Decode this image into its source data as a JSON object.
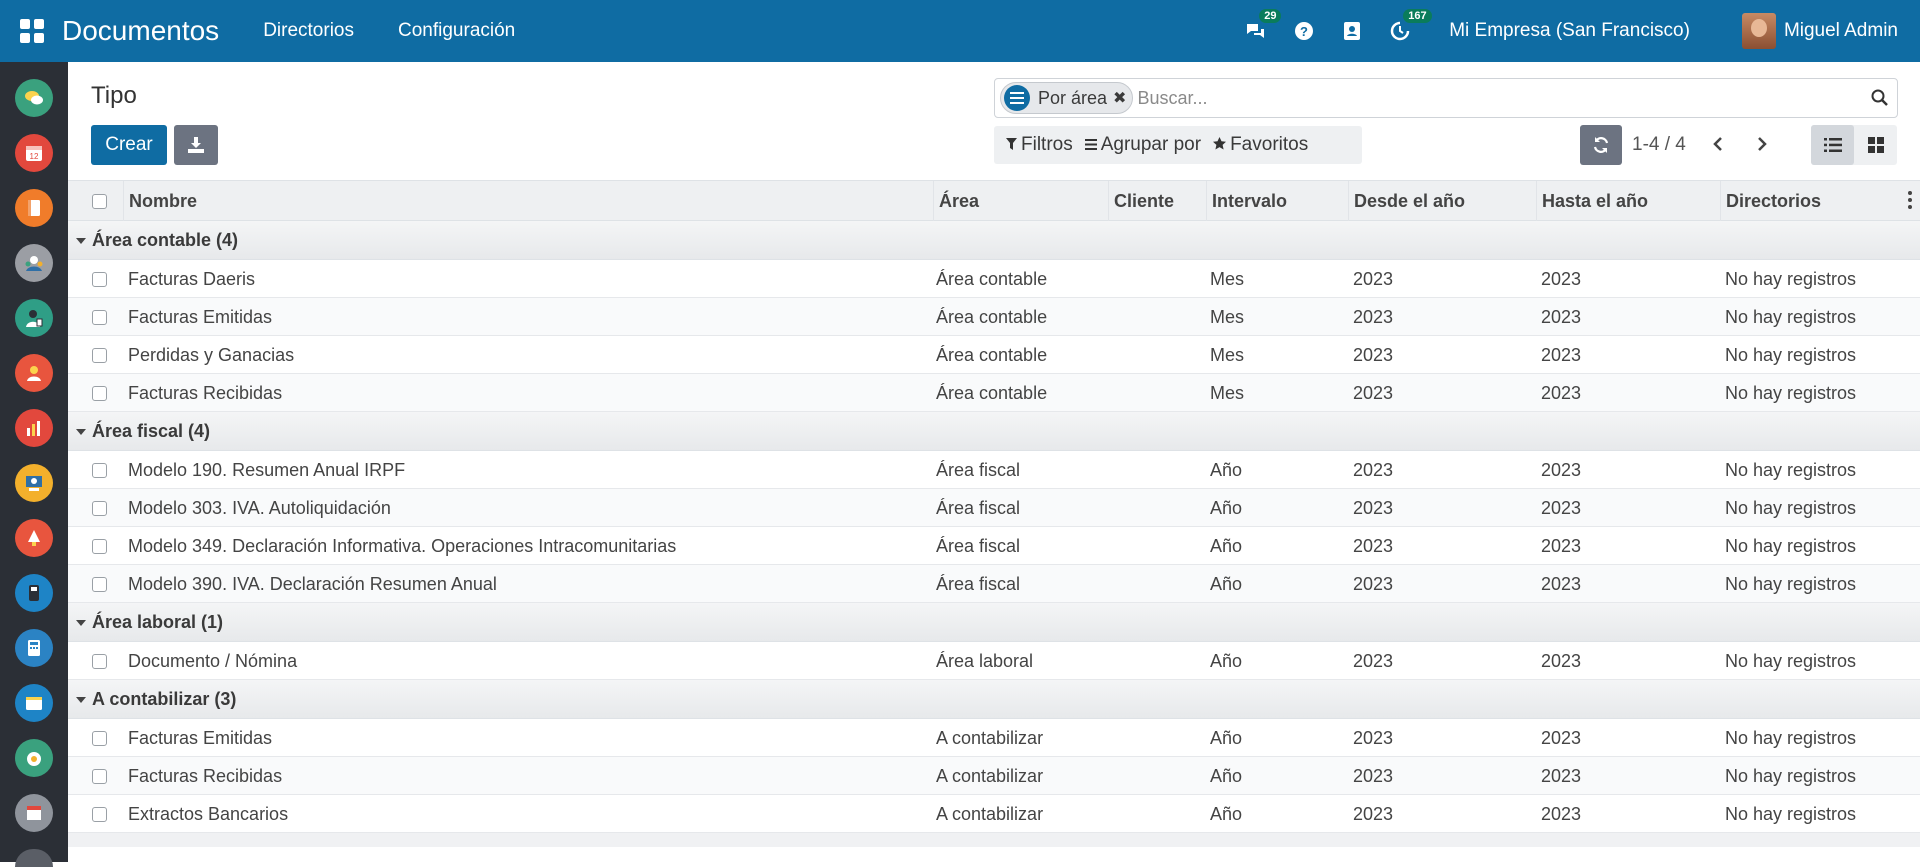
{
  "navbar": {
    "brand": "Documentos",
    "menu": [
      "Directorios",
      "Configuración"
    ],
    "chat_badge": "29",
    "activity_badge": "167",
    "company": "Mi Empresa (San Francisco)",
    "user": "Miguel Admin",
    "color": "#0f6ca3"
  },
  "sidebar": {
    "apps": [
      {
        "icon": "discuss-icon",
        "color": "#3aa17e"
      },
      {
        "icon": "calendar-icon",
        "color": "#e2483d"
      },
      {
        "icon": "notes-icon",
        "color": "#f07c2a"
      },
      {
        "icon": "contacts-icon",
        "color": "#9b9ea4"
      },
      {
        "icon": "employees-icon",
        "color": "#2f9e86"
      },
      {
        "icon": "crm-icon",
        "color": "#e8553e"
      },
      {
        "icon": "reporting-icon",
        "color": "#e2483d"
      },
      {
        "icon": "meeting-icon",
        "color": "#f3b02c"
      },
      {
        "icon": "time-off-icon",
        "color": "#e8553e"
      },
      {
        "icon": "point-of-sale-icon",
        "color": "#1e84c6"
      },
      {
        "icon": "accounting-icon",
        "color": "#2b83c4"
      },
      {
        "icon": "planning-icon",
        "color": "#1e84c6"
      },
      {
        "icon": "lunch-icon",
        "color": "#3aa17e"
      },
      {
        "icon": "website-icon",
        "color": "#8f949c"
      }
    ]
  },
  "page": {
    "title": "Tipo",
    "create_label": "Crear"
  },
  "search": {
    "facet_label": "Por área",
    "facet_close": "✖",
    "placeholder": "Buscar..."
  },
  "filters": {
    "filters_label": "Filtros",
    "group_by_label": "Agrupar por",
    "favorites_label": "Favoritos"
  },
  "pager": {
    "value": "1-4 / 4"
  },
  "table": {
    "columns": [
      "Nombre",
      "Área",
      "Cliente",
      "Intervalo",
      "Desde el año",
      "Hasta el año",
      "Directorios"
    ],
    "groups": [
      {
        "label": "Área contable (4)",
        "rows": [
          {
            "nombre": "Facturas Daeris",
            "area": "Área contable",
            "cliente": "",
            "intervalo": "Mes",
            "desde": "2023",
            "hasta": "2023",
            "directorios": "No hay registros"
          },
          {
            "nombre": "Facturas Emitidas",
            "area": "Área contable",
            "cliente": "",
            "intervalo": "Mes",
            "desde": "2023",
            "hasta": "2023",
            "directorios": "No hay registros"
          },
          {
            "nombre": "Perdidas y Ganacias",
            "area": "Área contable",
            "cliente": "",
            "intervalo": "Mes",
            "desde": "2023",
            "hasta": "2023",
            "directorios": "No hay registros"
          },
          {
            "nombre": "Facturas Recibidas",
            "area": "Área contable",
            "cliente": "",
            "intervalo": "Mes",
            "desde": "2023",
            "hasta": "2023",
            "directorios": "No hay registros"
          }
        ]
      },
      {
        "label": "Área fiscal (4)",
        "rows": [
          {
            "nombre": "Modelo 190. Resumen Anual IRPF",
            "area": "Área fiscal",
            "cliente": "",
            "intervalo": "Año",
            "desde": "2023",
            "hasta": "2023",
            "directorios": "No hay registros"
          },
          {
            "nombre": "Modelo 303. IVA. Autoliquidación",
            "area": "Área fiscal",
            "cliente": "",
            "intervalo": "Año",
            "desde": "2023",
            "hasta": "2023",
            "directorios": "No hay registros"
          },
          {
            "nombre": "Modelo 349. Declaración Informativa. Operaciones Intracomunitarias",
            "area": "Área fiscal",
            "cliente": "",
            "intervalo": "Año",
            "desde": "2023",
            "hasta": "2023",
            "directorios": "No hay registros"
          },
          {
            "nombre": "Modelo 390. IVA. Declaración Resumen Anual",
            "area": "Área fiscal",
            "cliente": "",
            "intervalo": "Año",
            "desde": "2023",
            "hasta": "2023",
            "directorios": "No hay registros"
          }
        ]
      },
      {
        "label": "Área laboral (1)",
        "rows": [
          {
            "nombre": "Documento / Nómina",
            "area": "Área laboral",
            "cliente": "",
            "intervalo": "Año",
            "desde": "2023",
            "hasta": "2023",
            "directorios": "No hay registros"
          }
        ]
      },
      {
        "label": "A contabilizar (3)",
        "rows": [
          {
            "nombre": "Facturas Emitidas",
            "area": "A contabilizar",
            "cliente": "",
            "intervalo": "Año",
            "desde": "2023",
            "hasta": "2023",
            "directorios": "No hay registros"
          },
          {
            "nombre": "Facturas Recibidas",
            "area": "A contabilizar",
            "cliente": "",
            "intervalo": "Año",
            "desde": "2023",
            "hasta": "2023",
            "directorios": "No hay registros"
          },
          {
            "nombre": "Extractos Bancarios",
            "area": "A contabilizar",
            "cliente": "",
            "intervalo": "Año",
            "desde": "2023",
            "hasta": "2023",
            "directorios": "No hay registros"
          }
        ]
      }
    ]
  }
}
